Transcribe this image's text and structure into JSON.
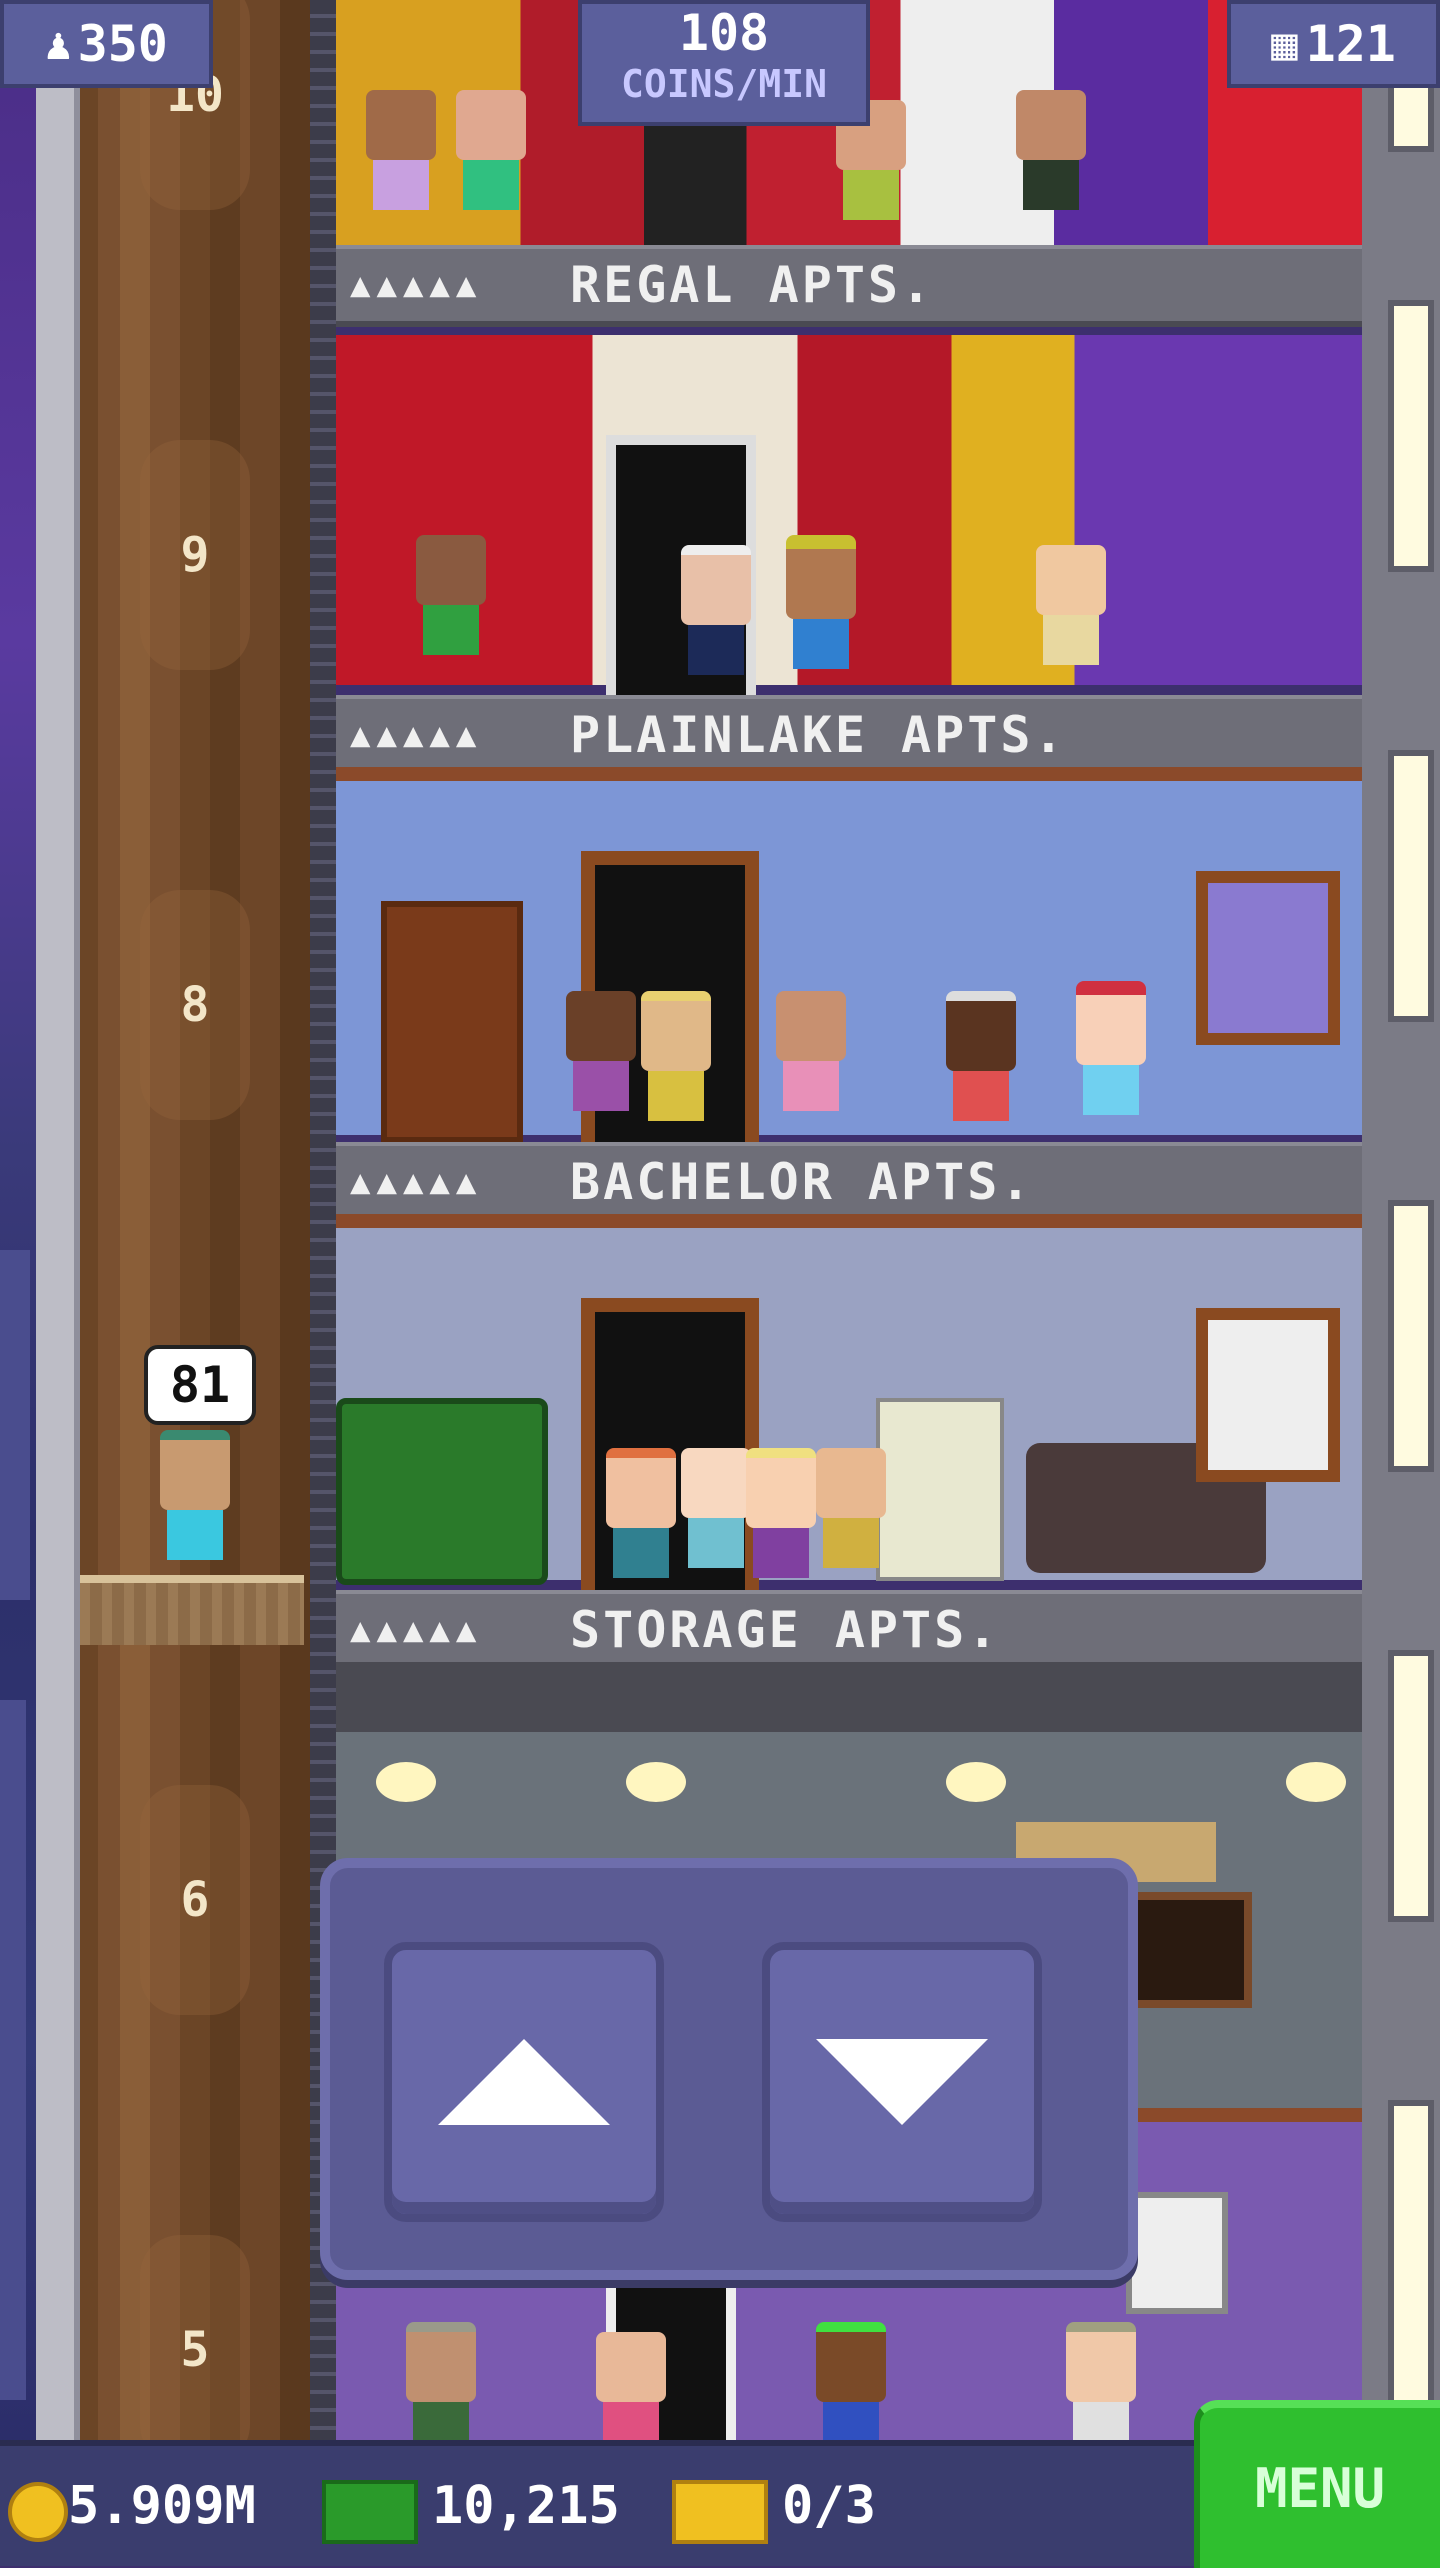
{
  "hud": {
    "population": "350",
    "coins_per_min_value": "108",
    "coins_per_min_label": "COINS/MIN",
    "floors": "121"
  },
  "elevator": {
    "passenger_bubble": "81",
    "floor_labels": [
      "10",
      "9",
      "8",
      "6",
      "5"
    ]
  },
  "floors": [
    {
      "name": "REGAL APTS.",
      "stars": "▲▲▲▲▲"
    },
    {
      "name": "PLAINLAKE APTS.",
      "stars": "▲▲▲▲▲"
    },
    {
      "name": "BACHELOR APTS.",
      "stars": "▲▲▲▲▲"
    },
    {
      "name": "STORAGE APTS.",
      "stars": "▲▲▲▲▲"
    }
  ],
  "bottom": {
    "coins": "5.909M",
    "bux": "10,215",
    "tickets": "0/3",
    "menu_label": "MENU"
  },
  "icons": {
    "population": "person-icon",
    "floors": "building-icon",
    "coin": "coin-icon",
    "bux": "bux-icon",
    "ticket": "ticket-icon",
    "up": "arrow-up-icon",
    "down": "arrow-down-icon"
  },
  "colors": {
    "menu_button": "#2fbf2f",
    "hud_panel": "#5b5f9c",
    "elevator_panel": "#5b5b94"
  }
}
